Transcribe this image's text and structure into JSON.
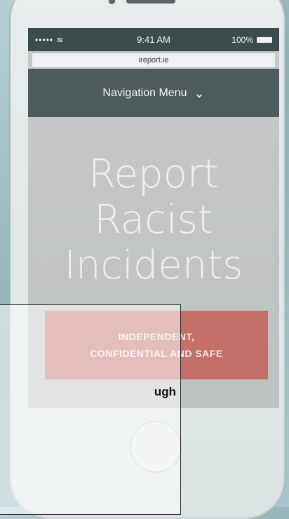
{
  "status_bar": {
    "signal": "••••• ≋",
    "time": "9:41 AM",
    "battery": "100%"
  },
  "browser": {
    "url": "ireport.ie"
  },
  "navigation": {
    "label": "Navigation Menu",
    "chevron": "chevron-down-icon"
  },
  "hero": {
    "title_line1": "Report",
    "title_line2": "Racist",
    "title_line3": "Incidents"
  },
  "cta": {
    "line1": "INDEPENDENT,",
    "line2": "CONFIDENTIAL AND SAFE"
  },
  "overlay": {
    "partial_text": "ugh"
  },
  "colors": {
    "navbar": "#4e5b5c",
    "status_bar": "#3c4b4c",
    "cta": "#c47068",
    "hero_bg": "#c6c8c8"
  }
}
